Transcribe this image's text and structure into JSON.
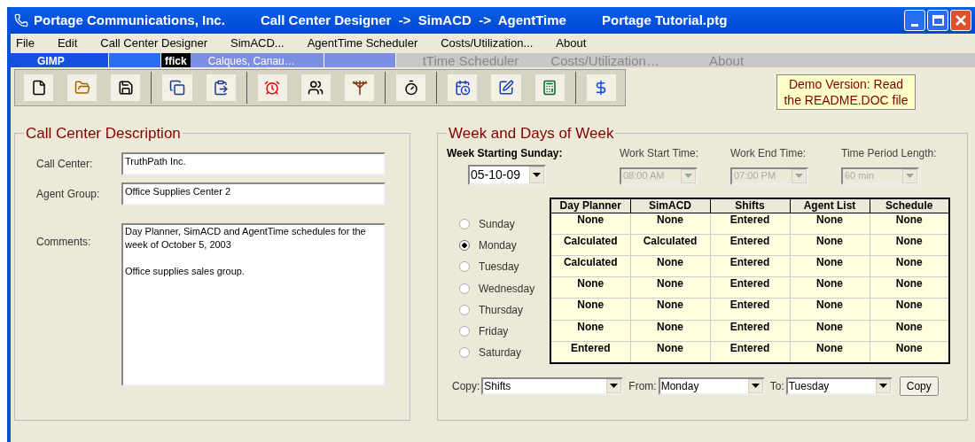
{
  "window": {
    "title_parts": [
      "Portage Communications, Inc.",
      "Call Center Designer  ->  SimACD  ->  AgentTime",
      "Portage Tutorial.ptg"
    ]
  },
  "menu": [
    {
      "label": "File"
    },
    {
      "label": "Edit"
    },
    {
      "label": "Call Center Designer"
    },
    {
      "label": "SimACD..."
    },
    {
      "label": "AgentTime Scheduler"
    },
    {
      "label": "Costs/Utilization..."
    },
    {
      "label": "About"
    }
  ],
  "overlay_strip": {
    "tasks": [
      "GIMP",
      "ffick",
      "Calques, Canau…"
    ],
    "ghost_menu": [
      "tTime Scheduler",
      "Costs/Utilization…",
      "About"
    ]
  },
  "demo_notice": "Demo Version: Read the README.DOC file",
  "call_center_description": {
    "title": "Call Center Description",
    "fields": [
      {
        "label": "Call Center:",
        "value": "TruthPath Inc."
      },
      {
        "label": "Agent Group:",
        "value": "Office Supplies Center 2"
      }
    ],
    "comments": {
      "label": "Comments:",
      "value": "Day Planner, SimACD and AgentTime schedules for the week of October 5, 2003\n\nOffice supplies sales group."
    }
  },
  "week": {
    "title": "Week and Days of Week",
    "week_start": {
      "label": "Week Starting Sunday:",
      "value": "05-10-09"
    },
    "settings": [
      {
        "label": "Work Start Time:",
        "value": "08:00 AM",
        "disabled": true
      },
      {
        "label": "Work End Time:",
        "value": "07:00 PM",
        "disabled": true
      },
      {
        "label": "Time Period Length:",
        "value": "60 min",
        "disabled": true
      }
    ],
    "days": [
      {
        "label": "Sunday",
        "selected": false
      },
      {
        "label": "Monday",
        "selected": true
      },
      {
        "label": "Tuesday",
        "selected": false
      },
      {
        "label": "Wednesday",
        "selected": false
      },
      {
        "label": "Thursday",
        "selected": false
      },
      {
        "label": "Friday",
        "selected": false
      },
      {
        "label": "Saturday",
        "selected": false
      }
    ],
    "table": {
      "columns": [
        "Day Planner",
        "SimACD",
        "Shifts",
        "Agent List",
        "Schedule"
      ],
      "rows": [
        [
          "None",
          "None",
          "Entered",
          "None",
          "None"
        ],
        [
          "Calculated",
          "Calculated",
          "Entered",
          "None",
          "None"
        ],
        [
          "Calculated",
          "None",
          "Entered",
          "None",
          "None"
        ],
        [
          "None",
          "None",
          "Entered",
          "None",
          "None"
        ],
        [
          "None",
          "None",
          "Entered",
          "None",
          "None"
        ],
        [
          "None",
          "None",
          "Entered",
          "None",
          "None"
        ],
        [
          "Entered",
          "None",
          "Entered",
          "None",
          "None"
        ]
      ]
    },
    "copy_bar": {
      "selects": [
        {
          "label": "Copy:",
          "value": "Shifts"
        },
        {
          "label": "From:",
          "value": "Monday"
        },
        {
          "label": "To:",
          "value": "Tuesday"
        }
      ],
      "button": "Copy"
    }
  }
}
